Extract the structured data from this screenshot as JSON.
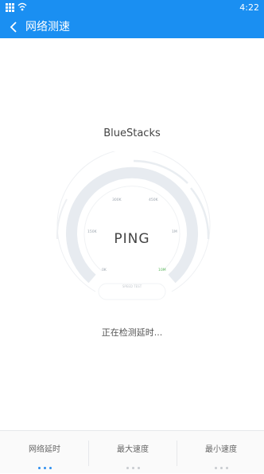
{
  "status_bar": {
    "time": "4:22"
  },
  "app_bar": {
    "title": "网络测速"
  },
  "test": {
    "host": "BlueStacks",
    "ping_label": "PING",
    "status": "正在检测延时...",
    "unit_label": "SPEED TEST",
    "gauge_labels": [
      "0K",
      "150K",
      "300K",
      "450K",
      "1M",
      "10M"
    ],
    "active_label": "10M"
  },
  "tabs": [
    {
      "label": "网络延时",
      "active": true
    },
    {
      "label": "最大速度",
      "active": false
    },
    {
      "label": "最小速度",
      "active": false
    }
  ],
  "colors": {
    "accent": "#1a8ff2",
    "gauge_track": "#e7ebf0",
    "active_label": "#5cb85c"
  }
}
